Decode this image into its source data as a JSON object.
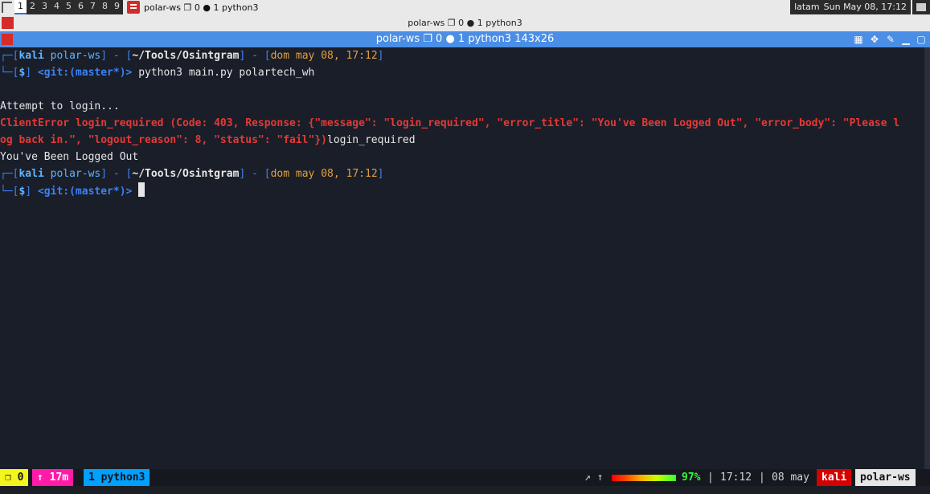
{
  "topbar": {
    "workspaces": [
      "1",
      "2",
      "3",
      "4",
      "5",
      "6",
      "7",
      "8",
      "9"
    ],
    "active_workspace": "1",
    "task_title": "polar-ws ❐ 0 ● 1 python3",
    "layout": "latam",
    "datetime": "Sun May 08, 17:12"
  },
  "title_strip": {
    "text": "polar-ws ❐ 0 ● 1 python3"
  },
  "window": {
    "title": "polar-ws ❐ 0 ● 1 python3 143x26",
    "buttons": [
      "grid-icon",
      "move-icon",
      "pin-icon",
      "minimize-icon",
      "maximize-icon",
      "close-icon"
    ]
  },
  "terminal": {
    "prompt1": {
      "corner_top": "┌─[",
      "user": "kali",
      "host": "polar-ws",
      "mid": "] - [",
      "path": "~/Tools/Osintgram",
      "mid2": "] - [",
      "date": "dom may 08, 17:12",
      "end": "]",
      "corner_bottom": "└─[",
      "dollar": "$",
      "close": "]",
      "git": "<git:(master*)>",
      "command": "python3 main.py polartech_wh"
    },
    "out_attempt": "Attempt to login...",
    "out_error1": "ClientError login_required (Code: 403, Response: {\"message\": \"login_required\", \"error_title\": \"You've Been Logged Out\", \"error_body\": \"Please l",
    "out_error2": "og back in.\", \"logout_reason\": 8, \"status\": \"fail\"})",
    "out_error2_tail": "login_required",
    "out_logged_out": "You've Been Logged Out",
    "prompt2": {
      "corner_top": "┌─[",
      "user": "kali",
      "host": "polar-ws",
      "mid": "] - [",
      "path": "~/Tools/Osintgram",
      "mid2": "] - [",
      "date": "dom may 08, 17:12",
      "end": "]",
      "corner_bottom": "└─[",
      "dollar": "$",
      "close": "]",
      "git": "<git:(master*)>"
    }
  },
  "statusbar": {
    "session": "❐ 0",
    "uptime": "↑ 17m",
    "window": "1 python3",
    "arrows": "↗ ↑",
    "battery_level": 0.97,
    "battery_text": "97%",
    "sep1": "|",
    "time": "17:12",
    "sep2": "|",
    "date": "08 may",
    "user": "kali",
    "host": "polar-ws"
  },
  "colors": {
    "titlebar": "#4a8ee6",
    "terminal_bg": "#1a1e28",
    "error": "#e53935",
    "accent_blue": "#3b82f6"
  }
}
